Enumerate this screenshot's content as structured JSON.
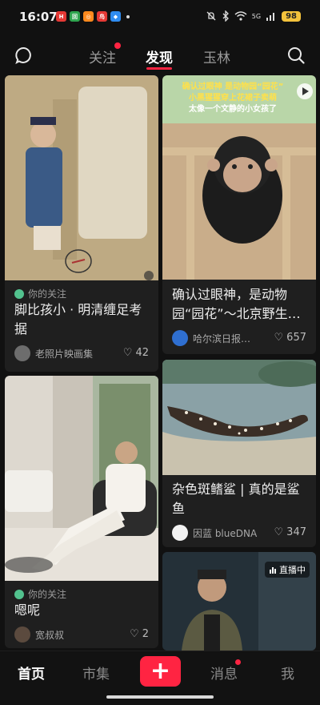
{
  "status_bar": {
    "time": "16:07",
    "network": "5G",
    "battery": "98",
    "apps": [
      {
        "glyph": "H",
        "color": "#e53935"
      },
      {
        "glyph": "回",
        "color": "#2fa54f"
      },
      {
        "glyph": "◎",
        "color": "#ff8a1e"
      },
      {
        "glyph": "鸟",
        "color": "#e53935"
      },
      {
        "glyph": "◆",
        "color": "#2f8cf0"
      }
    ]
  },
  "header": {
    "tabs": [
      {
        "label": "关注"
      },
      {
        "label": "发现"
      },
      {
        "label": "玉林"
      }
    ],
    "accent_color": "#ff2442"
  },
  "feed": [
    {
      "follow_tag": "你的关注",
      "title": "脚比孩小 · 明清缠足考据",
      "author": "老照片映画集",
      "likes": "42"
    },
    {
      "overlay_line1": "确认过眼神 是动物园“园花”",
      "overlay_line2": "小黑猩猩穿上花裙子卖萌",
      "overlay_line3": "太像一个文静的小女孩了",
      "title": "确认过眼神，是动物园“园花”～北京野生…",
      "author": "哈尔滨日报…",
      "likes": "657"
    },
    {
      "follow_tag": "你的关注",
      "title": "嗯呢",
      "author": "宽叔叔",
      "likes": "2"
    },
    {
      "title": "杂色斑鳍鲨 | 真的是鲨鱼",
      "author": "因蓝 blueDNA",
      "likes": "347"
    },
    {
      "live_badge": "直播中"
    }
  ],
  "bottom_nav": {
    "items": [
      {
        "label": "首页"
      },
      {
        "label": "市集"
      },
      {
        "label": "+"
      },
      {
        "label": "消息"
      },
      {
        "label": "我"
      }
    ]
  }
}
